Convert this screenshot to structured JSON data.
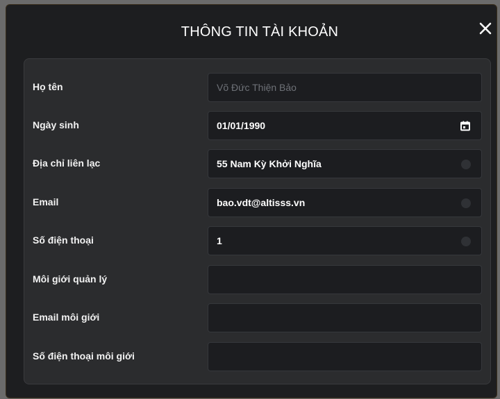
{
  "dialog": {
    "title": "THÔNG TIN TÀI KHOẢN",
    "close_icon": "close-icon"
  },
  "fields": [
    {
      "label": "Họ tên",
      "value": "Võ Đức Thiện Bảo",
      "disabled": true
    },
    {
      "label": "Ngày sinh",
      "value": "01/01/1990",
      "icon": "calendar-icon"
    },
    {
      "label": "Địa chỉ liên lạc",
      "value": "55 Nam Kỳ Khởi Nghĩa"
    },
    {
      "label": "Email",
      "value": "bao.vdt@altisss.vn"
    },
    {
      "label": "Số điện thoại",
      "value": "1"
    },
    {
      "label": "Môi giới quản lý",
      "value": ""
    },
    {
      "label": "Email môi giới",
      "value": ""
    },
    {
      "label": "Số điện thoại môi giới",
      "value": ""
    }
  ],
  "colors": {
    "modal_bg": "#1d1e20",
    "panel_bg": "#2b2c2e",
    "input_bg": "#1c1d20",
    "text": "#ffffff",
    "muted_text": "#6e7177"
  }
}
